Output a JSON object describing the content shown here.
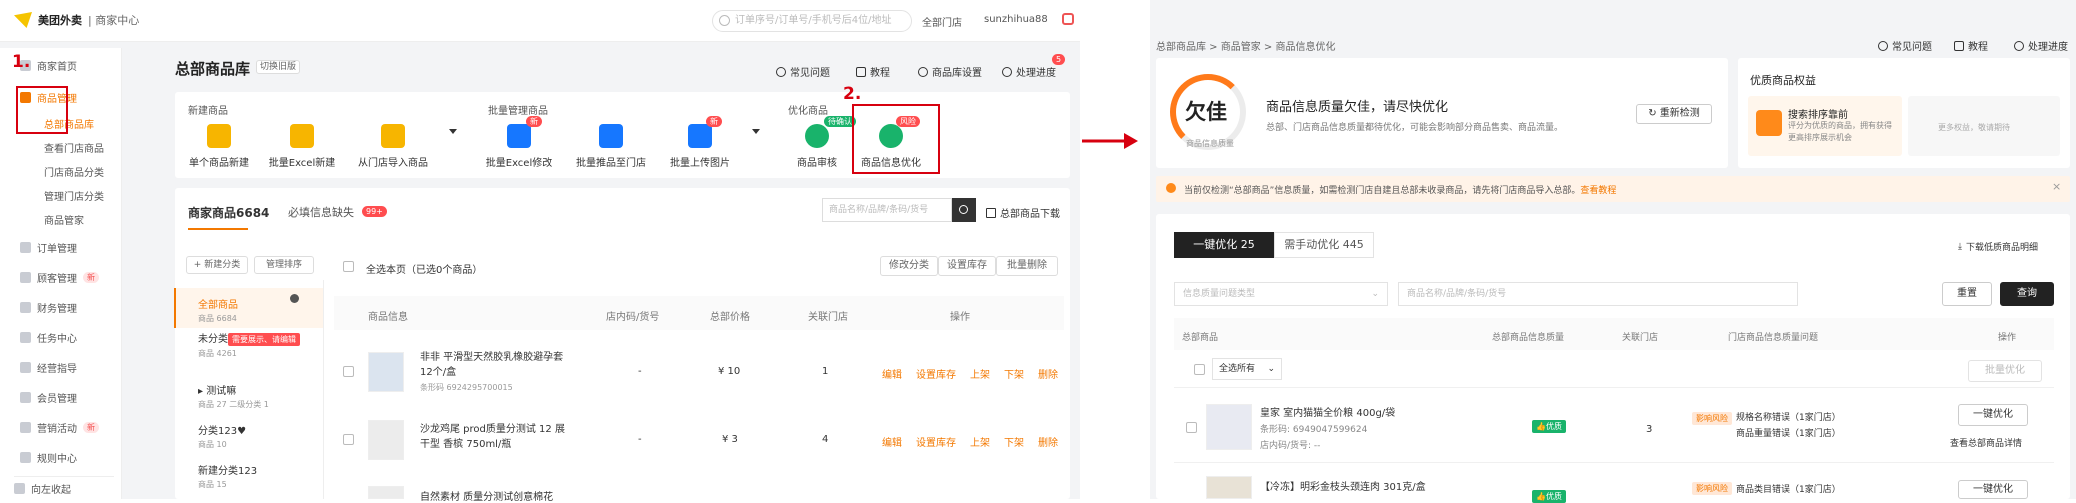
{
  "topbar": {
    "brand": "美团外卖",
    "brand_sub": "商家中心",
    "search_placeholder": "订单序号/订单号/手机号后4位/地址",
    "store": "全部门店",
    "user": "sunzhihua88"
  },
  "sidebar": {
    "items": [
      {
        "label": "商家首页"
      },
      {
        "label": "商品管理"
      },
      {
        "label": "总部商品库"
      },
      {
        "label": "查看门店商品"
      },
      {
        "label": "门店商品分类"
      },
      {
        "label": "管理门店分类"
      },
      {
        "label": "商品管家"
      },
      {
        "label": "订单管理"
      },
      {
        "label": "顾客管理",
        "tag": "新"
      },
      {
        "label": "财务管理"
      },
      {
        "label": "任务中心"
      },
      {
        "label": "经营指导"
      },
      {
        "label": "会员管理"
      },
      {
        "label": "营销活动",
        "tag": "新"
      },
      {
        "label": "规则中心"
      }
    ],
    "collapse": "向左收起",
    "step1": "1."
  },
  "main": {
    "title": "总部商品库",
    "switch_old": "切换旧版",
    "links": {
      "faq": "常见问题",
      "tutorial": "教程",
      "settings": "商品库设置",
      "progress": "处理进度",
      "progress_count": "5"
    },
    "sections": {
      "new": "新建商品",
      "batch": "批量管理商品",
      "optimize": "优化商品"
    },
    "tools": [
      {
        "label": "单个商品新建"
      },
      {
        "label": "批量Excel新建"
      },
      {
        "label": "从门店导入商品"
      },
      {
        "label": "批量Excel修改",
        "badge": "新"
      },
      {
        "label": "批量推品至门店"
      },
      {
        "label": "批量上传图片",
        "badge": "新"
      },
      {
        "label": "商品审核",
        "badge": "待确认"
      },
      {
        "label": "商品信息优化",
        "badge": "风险"
      }
    ],
    "step2": "2.",
    "tab_merchant": "商家商品6684",
    "tab_missing": "必填信息缺失",
    "tab_missing_count": "99+",
    "search_placeholder": "商品名称/品牌/条码/货号",
    "download": "总部商品下载",
    "cat_buttons": {
      "new": "+ 新建分类",
      "sort": "管理排序"
    },
    "categories": [
      {
        "name": "全部商品",
        "count": "商品 6684"
      },
      {
        "name": "未分类",
        "count": "商品 4261",
        "warn": "需要展示、请编辑"
      },
      {
        "name": "测试嘛",
        "count": "商品 27 二级分类 1"
      },
      {
        "name": "分类123♥",
        "count": "商品 10"
      },
      {
        "name": "新建分类123",
        "count": "商品 15"
      }
    ],
    "select_page": "全选本页（已选0个商品）",
    "bulk": {
      "edit_cat": "修改分类",
      "set_stock": "设置库存",
      "bulk_delete": "批量删除"
    },
    "columns": {
      "info": "商品信息",
      "code": "店内码/货号",
      "price": "总部价格",
      "stores": "关联门店",
      "ops": "操作"
    },
    "rows": [
      {
        "name": "非非 平滑型天然胶乳橡胶避孕套 12个/盒",
        "barcode": "条形码 6924295700015",
        "code": "-",
        "price": "¥ 10",
        "stores": "1"
      },
      {
        "name": "沙龙鸡尾 prod质量分测试 12 展干型 香槟 750ml/瓶",
        "barcode": "",
        "code": "-",
        "price": "¥ 3",
        "stores": "4"
      },
      {
        "name": "自然素材 质量分测试创意棉花",
        "barcode": "",
        "code": "",
        "price": "",
        "stores": ""
      }
    ],
    "ops": [
      "编辑",
      "设置库存",
      "上架",
      "下架",
      "删除"
    ]
  },
  "right": {
    "breadcrumb": "总部商品库 > 商品管家 > 商品信息优化",
    "links": {
      "faq": "常见问题",
      "tutorial": "教程",
      "progress": "处理进度"
    },
    "quality_level": "欠佳",
    "quality_caption": "商品信息质量",
    "quality_title": "商品信息质量欠佳，请尽快优化",
    "quality_desc": "总部、门店商品信息质量都待优化，可能会影响部分商品售卖、商品流量。",
    "recheck": "重新检测",
    "benefits_title": "优质商品权益",
    "benefit1_title": "搜索排序靠前",
    "benefit1_desc": "评分为优质的商品，拥有获得更高排序展示机会",
    "benefit2": "更多权益，敬请期待",
    "notice": "当前仅检测“总部商品”信息质量，如需检测门店自建且总部未收录商品，请先将门店商品导入总部。",
    "notice_link": "查看教程",
    "tab_auto": "一键优化 25",
    "tab_manual": "需手动优化 445",
    "download": "下载低质商品明细",
    "filter_type": "信息质量问题类型",
    "filter_search": "商品名称/品牌/条码/货号",
    "reset": "重置",
    "query": "查询",
    "columns": {
      "product": "总部商品",
      "quality": "总部商品信息质量",
      "stores": "关联门店",
      "issues": "门店商品信息质量问题",
      "ops": "操作"
    },
    "select_all": "全选所有",
    "bulk_optimize": "批量优化",
    "rows": [
      {
        "name": "皇家 室内猫猫全价粮 400g/袋",
        "barcode": "条形码: 6949047599624",
        "code": "店内码/货号: --",
        "quality": "优质",
        "stores": "3",
        "risk": "影响风险",
        "issue1": "规格名称错误（1家门店）",
        "issue2": "商品重量错误（1家门店）",
        "btn": "一键优化",
        "link": "查看总部商品详情"
      },
      {
        "name": "【冷冻】明彩金枝头颈连肉 301克/盒",
        "barcode": "",
        "code": "",
        "quality": "优质",
        "stores": "",
        "risk": "影响风险",
        "issue1": "商品类目错误（1家门店）",
        "issue2": "",
        "btn": "一键优化",
        "link": ""
      }
    ]
  }
}
